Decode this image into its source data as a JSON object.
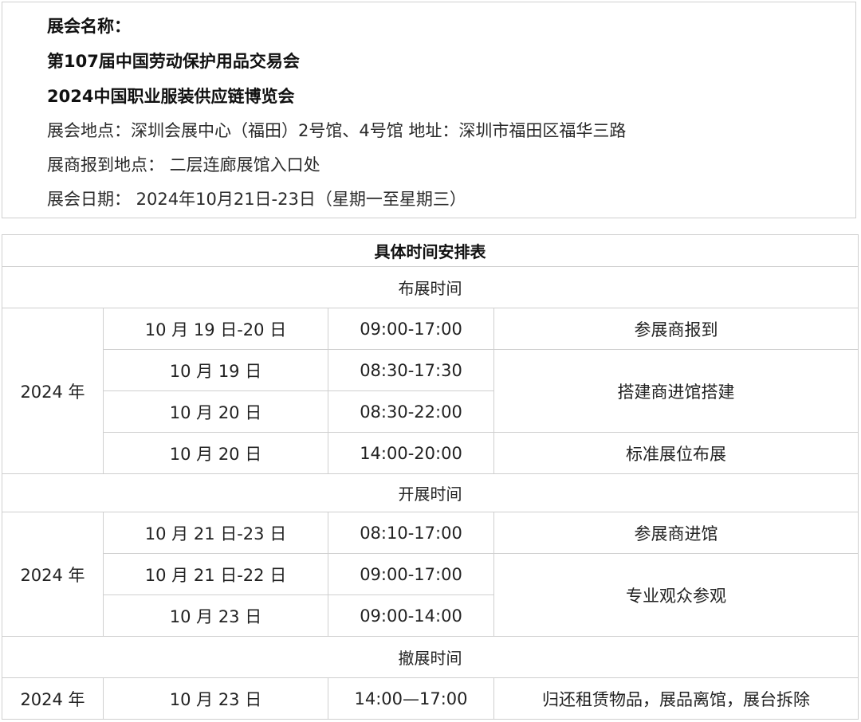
{
  "info": {
    "name_label": "展会名称：",
    "name_line1": "第107届中国劳动保护用品交易会",
    "name_line2": "2024中国职业服装供应链博览会",
    "location": "展会地点：深圳会展中心（福田）2号馆、4号馆   地址：深圳市福田区福华三路",
    "checkin": "展商报到地点：  二层连廊展馆入口处",
    "date": "展会日期：  2024年10月21日-23日（星期一至星期三）"
  },
  "schedule": {
    "title": "具体时间安排表",
    "setup": {
      "header": "布展时间",
      "year": "2024 年",
      "rows": [
        {
          "date": "10 月 19 日-20 日",
          "time": "09:00-17:00",
          "activity": "参展商报到"
        },
        {
          "date": "10 月 19 日",
          "time": "08:30-17:30",
          "activity": "搭建商进馆搭建"
        },
        {
          "date": "10 月 20 日",
          "time": "08:30-22:00"
        },
        {
          "date": "10 月 20 日",
          "time": "14:00-20:00",
          "activity": "标准展位布展"
        }
      ]
    },
    "open": {
      "header": "开展时间",
      "year": "2024 年",
      "rows": [
        {
          "date": "10 月 21 日-23 日",
          "time": "08:10-17:00",
          "activity": "参展商进馆"
        },
        {
          "date": "10 月 21 日-22 日",
          "time": "09:00-17:00",
          "activity": "专业观众参观"
        },
        {
          "date": "10 月 23 日",
          "time": "09:00-14:00"
        }
      ]
    },
    "teardown": {
      "header": "撤展时间",
      "year": "2024 年",
      "rows": [
        {
          "date": "10 月 23 日",
          "time": "14:00—17:00",
          "activity": "归还租赁物品，展品离馆，展台拆除"
        }
      ]
    }
  }
}
